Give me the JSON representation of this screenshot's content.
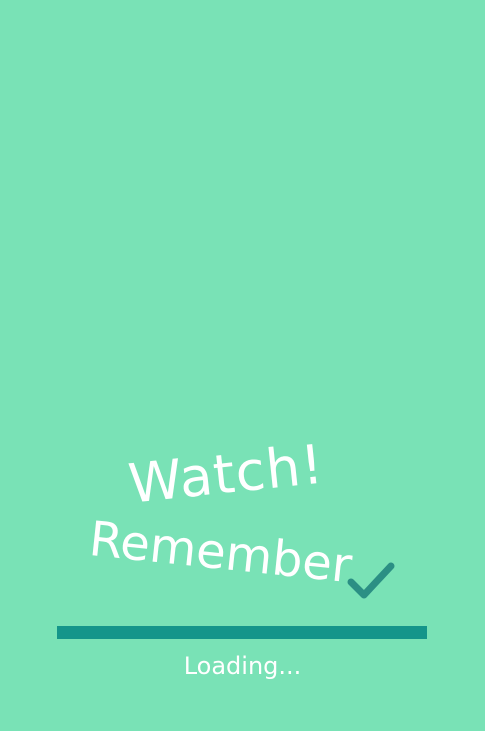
{
  "splash": {
    "logo_line1": "Watch!",
    "logo_line2": "Remember",
    "logo_icon": "checkmark-icon",
    "loading_text": "Loading...",
    "progress": 1.0
  },
  "colors": {
    "background": "#79e2b6",
    "progress_bar": "#14958a",
    "checkmark": "#2b8f84",
    "text": "#ffffff"
  }
}
